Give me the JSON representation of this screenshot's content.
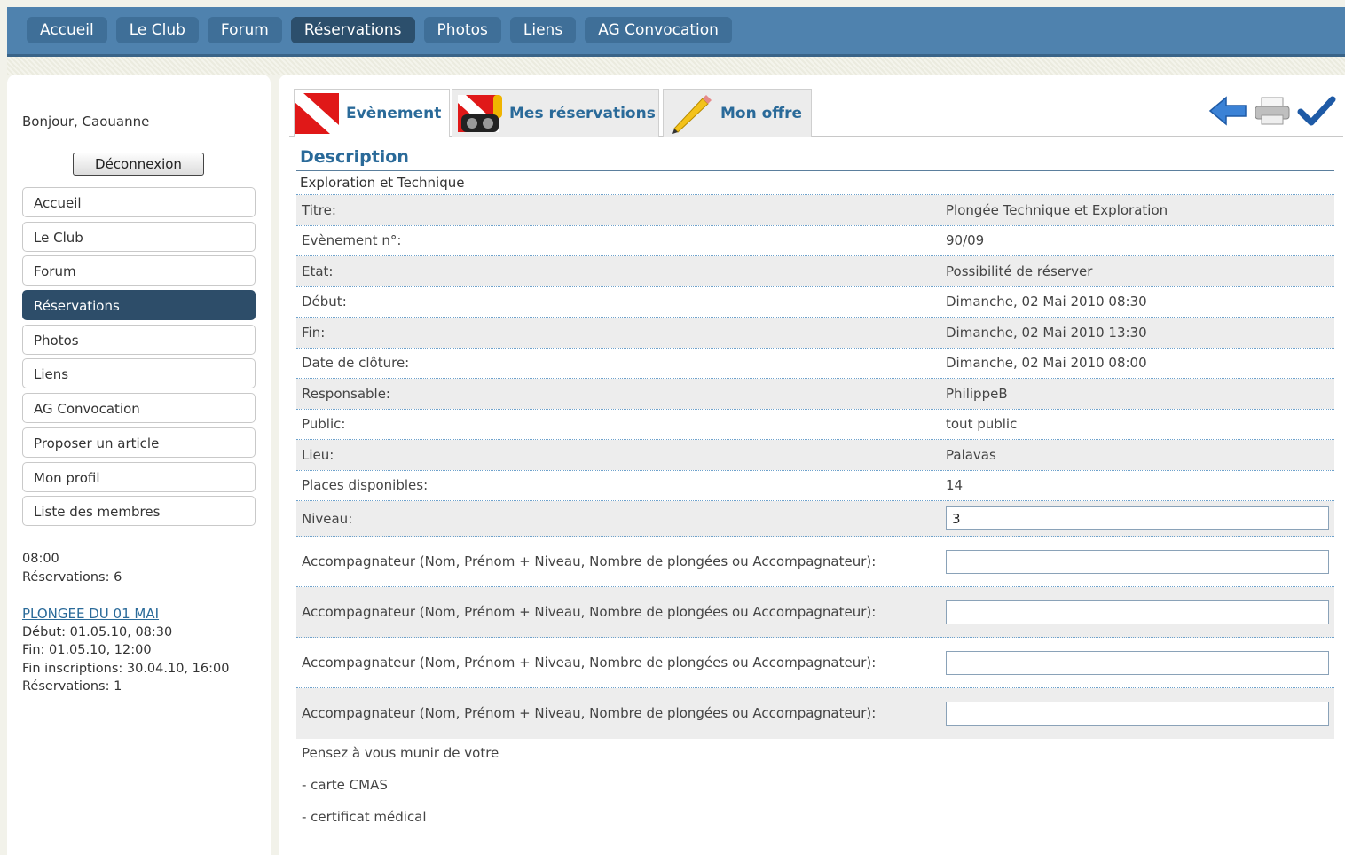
{
  "topnav": [
    "Accueil",
    "Le Club",
    "Forum",
    "Réservations",
    "Photos",
    "Liens",
    "AG Convocation"
  ],
  "topnav_active": "Réservations",
  "sidebar": {
    "greeting": "Bonjour, Caouanne",
    "logout_label": "Déconnexion",
    "menu": [
      "Accueil",
      "Le Club",
      "Forum",
      "Réservations",
      "Photos",
      "Liens",
      "AG Convocation",
      "Proposer un article",
      "Mon profil",
      "Liste des membres"
    ],
    "menu_active": "Réservations",
    "info_time": "08:00",
    "info_reservations": "Réservations: 6",
    "event": {
      "title": "PLONGEE DU 01 MAI",
      "debut": "Début: 01.05.10, 08:30",
      "fin": "Fin: 01.05.10, 12:00",
      "fin_inscriptions": "Fin inscriptions: 30.04.10, 16:00",
      "reservations": "Réservations: 1"
    }
  },
  "tabs": {
    "evenement": "Evènement",
    "mes_reservations": "Mes réservations",
    "mon_offre": "Mon offre"
  },
  "toolbar_icons": [
    "back-arrow-icon",
    "printer-icon",
    "checkmark-icon"
  ],
  "description": {
    "title": "Description",
    "subtitle": "Exploration et Technique"
  },
  "fields": [
    {
      "label": "Titre:",
      "value": "Plongée Technique et Exploration"
    },
    {
      "label": "Evènement n°:",
      "value": "90/09"
    },
    {
      "label": "Etat:",
      "value": "Possibilité de réserver"
    },
    {
      "label": "Début:",
      "value": "Dimanche, 02 Mai 2010 08:30"
    },
    {
      "label": "Fin:",
      "value": "Dimanche, 02 Mai 2010 13:30"
    },
    {
      "label": "Date de clôture:",
      "value": "Dimanche, 02 Mai 2010 08:00"
    },
    {
      "label": "Responsable:",
      "value": "PhilippeB"
    },
    {
      "label": "Public:",
      "value": "tout public"
    },
    {
      "label": "Lieu:",
      "value": "Palavas"
    },
    {
      "label": "Places disponibles:",
      "value": "14"
    }
  ],
  "inputs": {
    "niveau_label": "Niveau:",
    "niveau_value": "3",
    "accompagnateur_label": "Accompagnateur (Nom, Prénom + Niveau, Nombre de plongées ou Accompagnateur):",
    "accompagnateur_values": [
      "",
      "",
      "",
      ""
    ]
  },
  "notes": [
    "Pensez à vous munir de votre",
    "- carte CMAS",
    "- certificat médical"
  ],
  "colors": {
    "topbar": "#4f82ae",
    "active_nav": "#2d4d69",
    "link": "#2a6a99",
    "row_alt": "#ededed"
  }
}
